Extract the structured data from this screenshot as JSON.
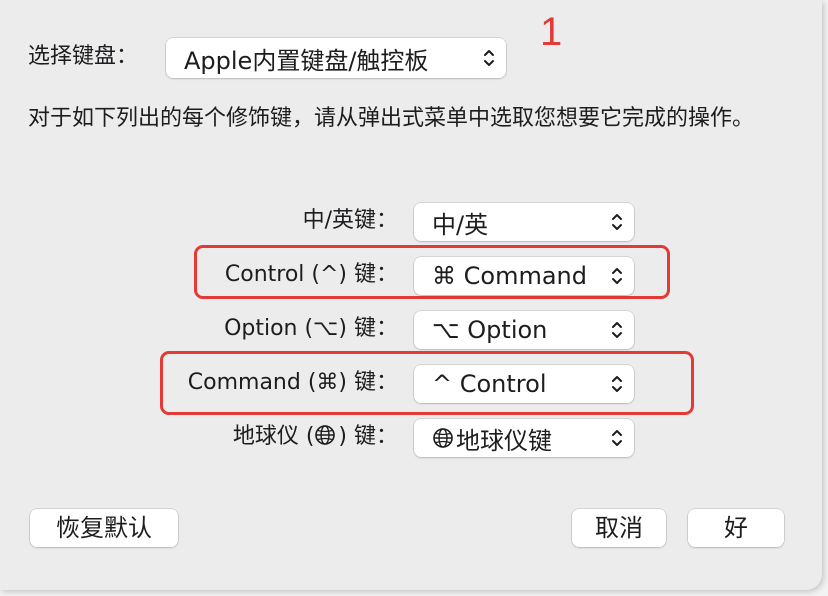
{
  "annotation": {
    "number": "1",
    "color": "#e53935"
  },
  "keyboard": {
    "label": "选择键盘：",
    "selected": "Apple内置键盘/触控板"
  },
  "description": "对于如下列出的每个修饰键，请从弹出式菜单中选取您想要它完成的操作。",
  "modifiers": [
    {
      "label": "中/英键：",
      "value": "中/英",
      "highlighted": false
    },
    {
      "label": "Control (^) 键：",
      "value": "⌘ Command",
      "highlighted": true
    },
    {
      "label": "Option (⌥) 键：",
      "value": "⌥ Option",
      "highlighted": false
    },
    {
      "label": "Command (⌘) 键：",
      "value": "^ Control",
      "highlighted": true
    },
    {
      "label_prefix": "地球仪 (",
      "label_suffix": ") 键：",
      "value": "地球仪键",
      "highlighted": false,
      "icon": "globe-icon"
    }
  ],
  "buttons": {
    "restore": "恢复默认",
    "cancel": "取消",
    "ok": "好"
  }
}
